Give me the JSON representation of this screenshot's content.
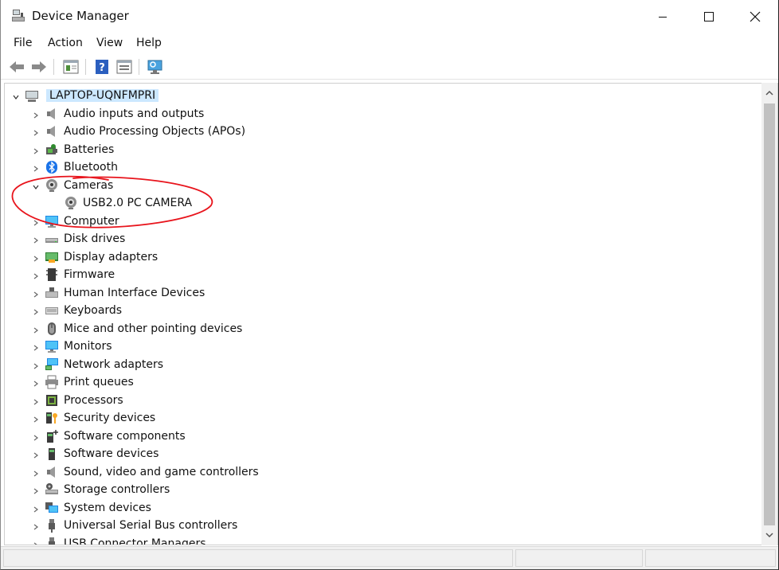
{
  "window": {
    "title": "Device Manager",
    "controls": {
      "minimize_icon": "minimize-icon",
      "maximize_icon": "maximize-icon",
      "close_icon": "close-icon"
    }
  },
  "menu": [
    "File",
    "Action",
    "View",
    "Help"
  ],
  "toolbar": {
    "buttons": [
      "back-icon",
      "forward-icon",
      "properties-icon",
      "help-icon",
      "details-icon",
      "scan-hardware-icon"
    ]
  },
  "tree": {
    "root": {
      "label": "LAPTOP-UQNFMPRI",
      "expanded": true,
      "selected": true
    },
    "categories": [
      {
        "label": "Audio inputs and outputs",
        "icon": "speaker-icon"
      },
      {
        "label": "Audio Processing Objects (APOs)",
        "icon": "speaker-icon"
      },
      {
        "label": "Batteries",
        "icon": "battery-icon"
      },
      {
        "label": "Bluetooth",
        "icon": "bluetooth-icon"
      },
      {
        "label": "Cameras",
        "icon": "camera-icon",
        "expanded": true,
        "children": [
          {
            "label": "USB2.0 PC CAMERA",
            "icon": "camera-icon"
          }
        ]
      },
      {
        "label": "Computer",
        "icon": "computer-icon"
      },
      {
        "label": "Disk drives",
        "icon": "disk-drive-icon"
      },
      {
        "label": "Display adapters",
        "icon": "display-adapter-icon"
      },
      {
        "label": "Firmware",
        "icon": "firmware-icon"
      },
      {
        "label": "Human Interface Devices",
        "icon": "hid-icon"
      },
      {
        "label": "Keyboards",
        "icon": "keyboard-icon"
      },
      {
        "label": "Mice and other pointing devices",
        "icon": "mouse-icon"
      },
      {
        "label": "Monitors",
        "icon": "monitor-icon"
      },
      {
        "label": "Network adapters",
        "icon": "network-adapter-icon"
      },
      {
        "label": "Print queues",
        "icon": "printer-icon"
      },
      {
        "label": "Processors",
        "icon": "processor-icon"
      },
      {
        "label": "Security devices",
        "icon": "security-device-icon"
      },
      {
        "label": "Software components",
        "icon": "software-component-icon"
      },
      {
        "label": "Software devices",
        "icon": "software-device-icon"
      },
      {
        "label": "Sound, video and game controllers",
        "icon": "sound-controller-icon"
      },
      {
        "label": "Storage controllers",
        "icon": "storage-controller-icon"
      },
      {
        "label": "System devices",
        "icon": "system-device-icon"
      },
      {
        "label": "Universal Serial Bus controllers",
        "icon": "usb-icon"
      },
      {
        "label": "USB Connector Managers",
        "icon": "usb-icon"
      }
    ]
  },
  "annotation": {
    "shape": "ellipse",
    "color": "#e8141c",
    "encircles": "Cameras"
  },
  "colors": {
    "selection": "#cce8ff",
    "scrollbar_thumb": "#c1c1c1"
  }
}
